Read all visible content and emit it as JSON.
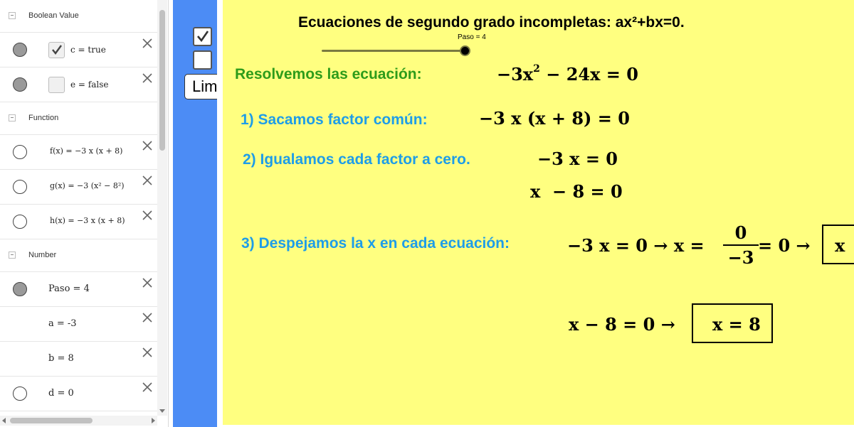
{
  "algebra": {
    "groups": [
      {
        "title": "Boolean Value",
        "rows": [
          {
            "text": "c = true"
          },
          {
            "text": "e = false"
          }
        ]
      },
      {
        "title": "Function",
        "rows": [
          {
            "text": "f(x) = −3 x (x + 8)"
          },
          {
            "text": "g(x) = −3 (x² − 8²)"
          },
          {
            "text": "h(x) = −3 x (x + 8)"
          }
        ]
      },
      {
        "title": "Number",
        "rows": [
          {
            "text": "Paso = 4"
          },
          {
            "text": "a = -3"
          },
          {
            "text": "b = 8"
          },
          {
            "text": "d = 0"
          }
        ]
      }
    ]
  },
  "toolbar": {
    "button_label": "Limpiar"
  },
  "graphics": {
    "title": "Ecuaciones de segundo grado incompletas: ax²+bx=0.",
    "slider": {
      "label": "Paso = 4",
      "value": 4
    },
    "step0": {
      "label": "Resolvemos las ecuación:",
      "equation_a": "−3x",
      "equation_exp": "2",
      "equation_b": " − 24x = 0"
    },
    "step1": {
      "label": "1) Sacamos factor común:",
      "equation": "−3 x (x + 8) = 0"
    },
    "step2": {
      "label": "2) Igualamos cada factor a cero.",
      "equation1": "−3 x = 0",
      "equation2": "x  − 8 = 0"
    },
    "step3": {
      "label": "3) Despejamos la x en cada ecuación:",
      "eq1_start": "−3 x = 0 →  x =",
      "eq1_num": "0",
      "eq1_den": "−3",
      "eq1_end": "= 0 →",
      "eq1_box": "x",
      "eq2_start": "x − 8 = 0  →",
      "eq2_box": "x = 8"
    }
  },
  "colors": {
    "yellow_bg": "#ffff80",
    "blue_strip": "#4c8cf5",
    "step_green": "#2e9c1a",
    "step_blue": "#1e9de8"
  }
}
